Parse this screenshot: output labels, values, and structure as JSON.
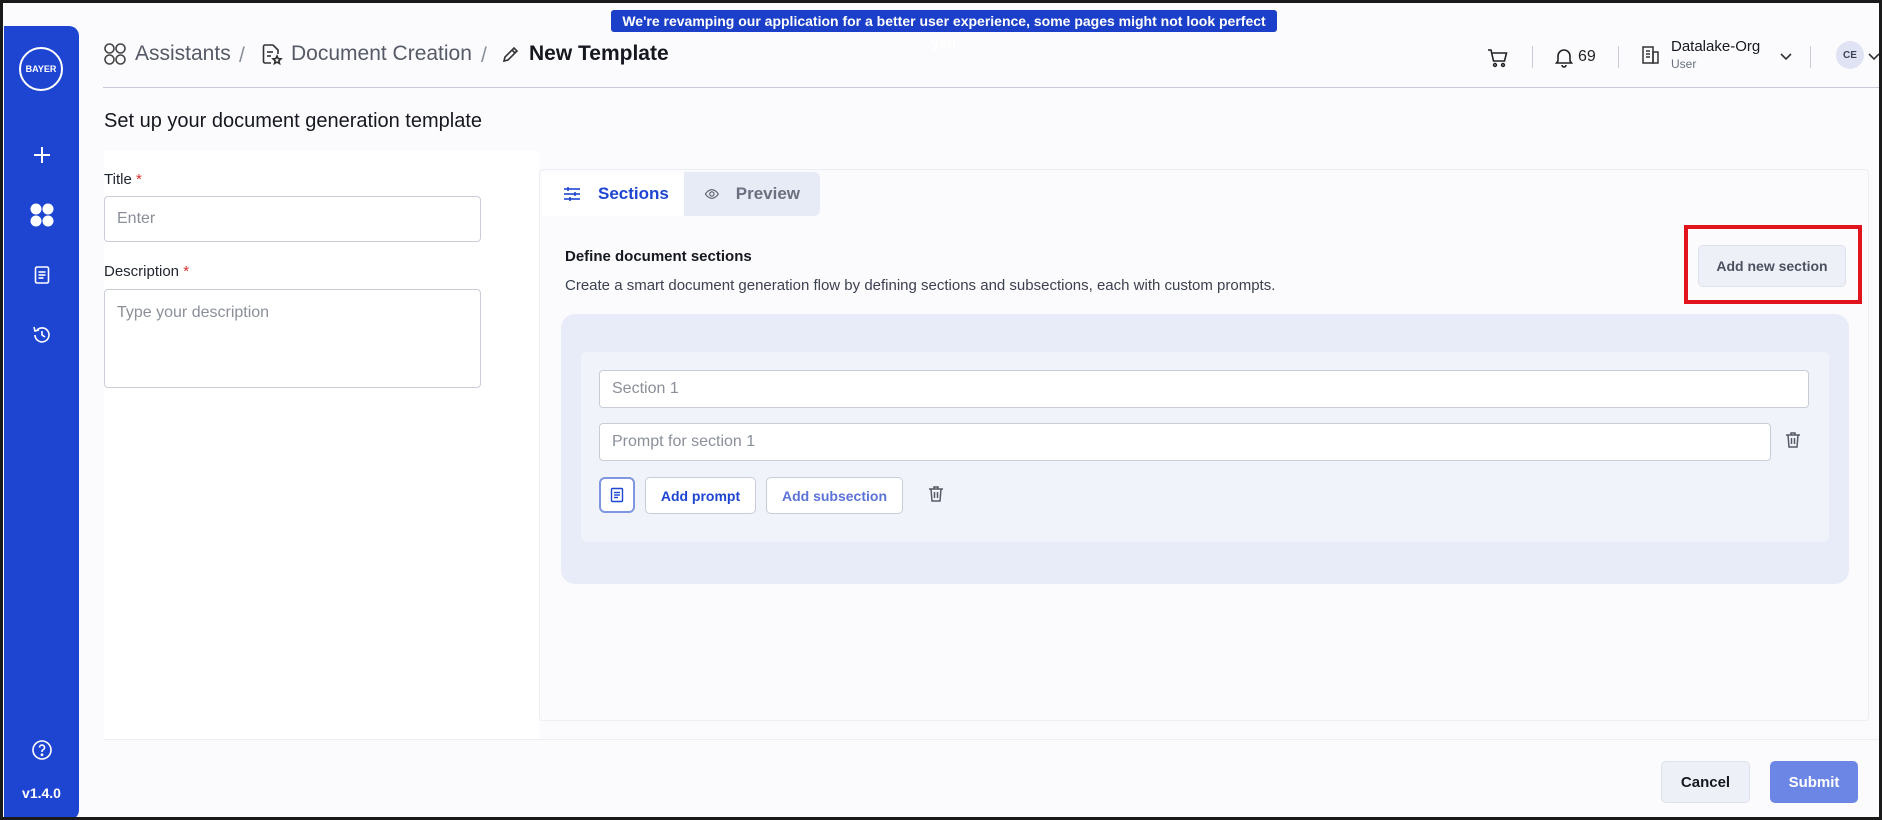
{
  "banner": {
    "text": "We're revamping our application for a better user experience, some pages might not look perfect yet!"
  },
  "sidebar": {
    "logo_text": "BAYER",
    "version": "v1.4.0"
  },
  "breadcrumb": {
    "items": [
      "Assistants",
      "Document Creation",
      "New Template"
    ],
    "separator": "/"
  },
  "header": {
    "notification_count": "69",
    "org_name": "Datalake-Org",
    "org_role": "User",
    "avatar_initials": "CE"
  },
  "page": {
    "title": "Set up your document generation template"
  },
  "form": {
    "title_label": "Title",
    "title_placeholder": "Enter",
    "description_label": "Description",
    "description_placeholder": "Type your description",
    "required_mark": "*"
  },
  "tabs": [
    {
      "label": "Sections",
      "active": true
    },
    {
      "label": "Preview",
      "active": false
    }
  ],
  "sections_panel": {
    "heading": "Define document sections",
    "description": "Create a smart document generation flow by defining sections and subsections, each with custom prompts.",
    "add_section_label": "Add new section",
    "section": {
      "name_placeholder": "Section 1",
      "prompt_placeholder": "Prompt for section 1",
      "add_prompt_label": "Add prompt",
      "add_subsection_label": "Add subsection"
    }
  },
  "footer": {
    "cancel_label": "Cancel",
    "submit_label": "Submit"
  },
  "colors": {
    "brand": "#1e45d2",
    "banner": "#1b3fc8",
    "submit": "#6c86e6",
    "highlight": "#e0141c"
  }
}
